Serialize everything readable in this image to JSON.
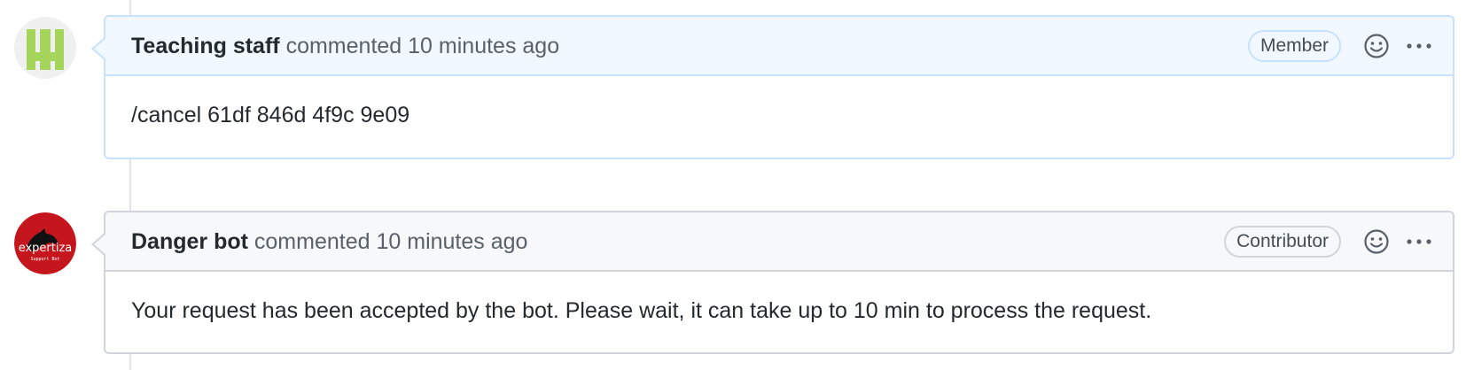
{
  "comments": [
    {
      "author": "Teaching staff",
      "action": "commented",
      "time": "10 minutes ago",
      "badge": "Member",
      "body": "/cancel 61df 846d 4f9c 9e09",
      "avatar": {
        "icon": "pixel-identicon-avatar",
        "color": "#a5d65b"
      }
    },
    {
      "author": "Danger bot",
      "action": "commented",
      "time": "10 minutes ago",
      "badge": "Contributor",
      "body": "Your request has been accepted by the bot. Please wait, it can take up to 10 min to process the request.",
      "avatar": {
        "icon": "expertiza-bot-avatar",
        "color": "#c4161c",
        "logo_text": "expertiza",
        "logo_subtext": "Support Bot"
      }
    }
  ],
  "icons": {
    "reaction": "smiley-icon",
    "more": "kebab-horizontal-icon"
  }
}
